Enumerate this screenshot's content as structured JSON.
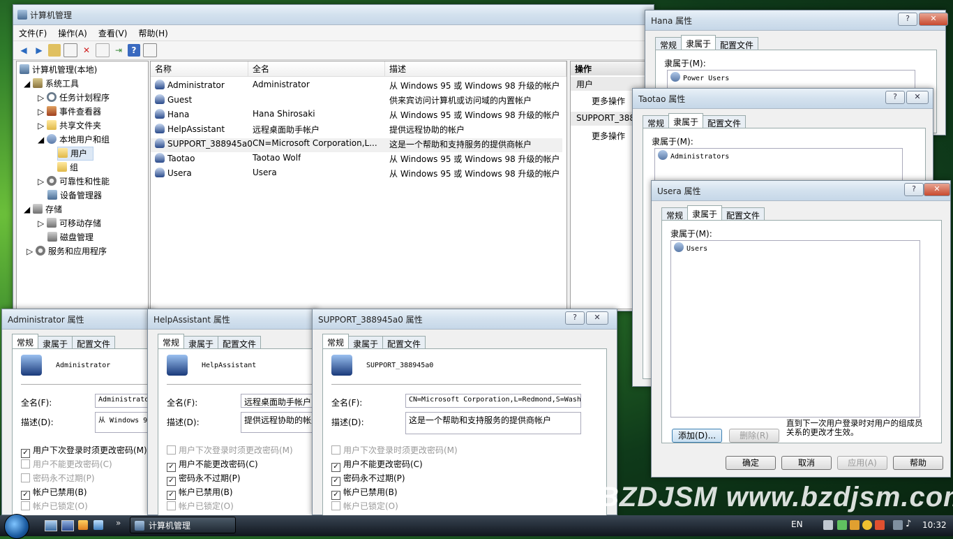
{
  "main_window": {
    "title": "计算机管理",
    "menu": [
      "文件(F)",
      "操作(A)",
      "查看(V)",
      "帮助(H)"
    ],
    "tree": [
      {
        "label": "计算机管理(本地)",
        "icon": "computer-management-icon"
      },
      {
        "label": "系统工具",
        "icon": "tools-icon"
      },
      {
        "label": "任务计划程序",
        "icon": "clock-icon"
      },
      {
        "label": "事件查看器",
        "icon": "event-viewer-icon"
      },
      {
        "label": "共享文件夹",
        "icon": "shared-folder-icon"
      },
      {
        "label": "本地用户和组",
        "icon": "users-icon"
      },
      {
        "label": "用户",
        "icon": "folder-icon"
      },
      {
        "label": "组",
        "icon": "folder-icon"
      },
      {
        "label": "可靠性和性能",
        "icon": "performance-icon"
      },
      {
        "label": "设备管理器",
        "icon": "device-manager-icon"
      },
      {
        "label": "存储",
        "icon": "storage-icon"
      },
      {
        "label": "可移动存储",
        "icon": "removable-storage-icon"
      },
      {
        "label": "磁盘管理",
        "icon": "disk-icon"
      },
      {
        "label": "服务和应用程序",
        "icon": "services-icon"
      }
    ],
    "columns": [
      "名称",
      "全名",
      "描述"
    ],
    "users": [
      {
        "name": "Administrator",
        "full": "Administrator",
        "desc": "从 Windows 95 或 Windows 98 升级的帐户"
      },
      {
        "name": "Guest",
        "full": "",
        "desc": "供来宾访问计算机或访问域的内置帐户"
      },
      {
        "name": "Hana",
        "full": "Hana Shirosaki",
        "desc": "从 Windows 95 或 Windows 98 升级的帐户"
      },
      {
        "name": "HelpAssistant",
        "full": "远程桌面助手帐户",
        "desc": "提供远程协助的帐户"
      },
      {
        "name": "SUPPORT_388945a0",
        "full": "CN=Microsoft Corporation,L...",
        "desc": "这是一个帮助和支持服务的提供商帐户"
      },
      {
        "name": "Taotao",
        "full": "Taotao Wolf",
        "desc": "从 Windows 95 或 Windows 98 升级的帐户"
      },
      {
        "name": "Usera",
        "full": "Usera",
        "desc": "从 Windows 95 或 Windows 98 升级的帐户"
      }
    ],
    "actions": {
      "header": "操作",
      "section1": "用户",
      "more1": "更多操作",
      "section2": "SUPPORT_388",
      "more2": "更多操作"
    }
  },
  "tabs": {
    "general": "常规",
    "member_of": "隶属于",
    "profile": "配置文件"
  },
  "hana_dialog": {
    "title": "Hana 属性",
    "member_label": "隶属于(M):",
    "group": "Power Users"
  },
  "taotao_dialog": {
    "title": "Taotao 属性",
    "member_label": "隶属于(M):",
    "group": "Administrators"
  },
  "usera_dialog": {
    "title": "Usera 属性",
    "member_label": "隶属于(M):",
    "group": "Users",
    "add": "添加(D)...",
    "remove": "删除(R)",
    "note": "直到下一次用户登录时对用户的组成员关系的更改才生效。",
    "ok": "确定",
    "cancel": "取消",
    "apply": "应用(A)",
    "help": "帮助"
  },
  "general_labels": {
    "fullname": "全名(F):",
    "desc": "描述(D):",
    "cb1": "用户下次登录时须更改密码(M)",
    "cb2": "用户不能更改密码(C)",
    "cb3": "密码永不过期(P)",
    "cb4": "帐户已禁用(B)",
    "cb5": "帐户已锁定(O)"
  },
  "admin_dialog": {
    "title": "Administrator 属性",
    "user": "Administrator",
    "fullname": "Administrato",
    "desc": "从 Windows 9"
  },
  "help_dialog": {
    "title": "HelpAssistant 属性",
    "user": "HelpAssistant",
    "fullname": "远程桌面助手帐户",
    "desc": "提供远程协助的帐户"
  },
  "support_dialog": {
    "title": "SUPPORT_388945a0 属性",
    "user": "SUPPORT_388945a0",
    "fullname": "CN=Microsoft Corporation,L=Redmond,S=Wash",
    "desc": "这是一个帮助和支持服务的提供商帐户"
  },
  "taskbar": {
    "task": "计算机管理",
    "lang": "EN",
    "time": "10:32"
  },
  "watermark": "BZDJSM www.bzdjsm.com"
}
